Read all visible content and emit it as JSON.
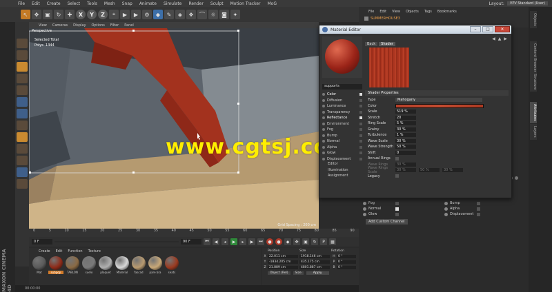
{
  "menubar": [
    "File",
    "Edit",
    "Create",
    "Select",
    "Tools",
    "Mesh",
    "Snap",
    "Animate",
    "Simulate",
    "Render",
    "Sculpt",
    "Motion Tracker",
    "MoG"
  ],
  "layout": {
    "label": "Layout:",
    "value": "VPV Standard (User)"
  },
  "toolbar": {
    "axes": [
      "X",
      "Y",
      "Z"
    ]
  },
  "viewport": {
    "menu": [
      "View",
      "Cameras",
      "Display",
      "Options",
      "Filter",
      "Panel"
    ],
    "label": "Perspective",
    "hud": {
      "selected": "Selected Total",
      "polys_label": "Polys",
      "polys_value": "1344"
    },
    "grid_spacing": "Grid Spacing : 200 cm"
  },
  "timeline": {
    "ticks": [
      "0",
      "5",
      "10",
      "15",
      "20",
      "25",
      "30",
      "35",
      "40",
      "45",
      "50",
      "55",
      "60",
      "65",
      "70",
      "75",
      "80",
      "85",
      "90"
    ],
    "start": "0 F",
    "end": "90 F",
    "current": "0 F"
  },
  "materials": {
    "menu": [
      "Create",
      "Edit",
      "Function",
      "Texture"
    ],
    "items": [
      {
        "name": "Mat",
        "color": "#5a5a5a"
      },
      {
        "name": "subpop",
        "color": "#8e2a18",
        "selected": true
      },
      {
        "name": "TABLON",
        "color": "#8a6a44"
      },
      {
        "name": "suelo",
        "color": "#7a7a7a"
      },
      {
        "name": "plaquet",
        "color": "#b0b0b0"
      },
      {
        "name": "Material",
        "color": "#d8d8d8"
      },
      {
        "name": "fascad",
        "color": "#b89a70"
      },
      {
        "name": "pare bra",
        "color": "#c8a878"
      },
      {
        "name": "seats",
        "color": "#9a3a20"
      }
    ]
  },
  "coords": {
    "headers": [
      "Position",
      "Size",
      "Rotation"
    ],
    "rows": [
      {
        "axis": "X",
        "pos": "22.011 cm",
        "size": "1918.146 cm",
        "rot_axis": "H",
        "rot": "0 °"
      },
      {
        "axis": "Y",
        "pos": "-1834.205 cm",
        "size": "435.175 cm",
        "rot_axis": "P",
        "rot": "0 °"
      },
      {
        "axis": "Z",
        "pos": "21.889 cm",
        "size": "4801.887 cm",
        "rot_axis": "B",
        "rot": "0 °"
      }
    ],
    "mode": "Object (Rel)",
    "size_mode": "Size",
    "apply": "Apply"
  },
  "statusbar": "00:00:00",
  "brand": "MAXON CINEMA 4D",
  "objmgr": {
    "menu": [
      "File",
      "Edit",
      "View",
      "Objects",
      "Tags",
      "Bookmarks"
    ],
    "object": "SUMMERHOUSE3"
  },
  "right_tabs": [
    "Objects",
    "Content Browser",
    "Structure",
    "Attributes",
    "Layers"
  ],
  "attr_lower": {
    "items": [
      {
        "label": "Fog",
        "checked": false
      },
      {
        "label": "Bump",
        "checked": false
      },
      {
        "label": "Normal",
        "checked": true
      },
      {
        "label": "Alpha",
        "checked": false
      },
      {
        "label": "Glow",
        "checked": false
      },
      {
        "label": "Displacement",
        "checked": false
      }
    ],
    "add_channel": "Add Custom Channel"
  },
  "material_editor": {
    "title": "Material Editor",
    "material_name": "supports",
    "tabs": [
      "Back",
      "Shader"
    ],
    "channels": [
      {
        "label": "Color",
        "on": true
      },
      {
        "label": "Diffusion",
        "on": false
      },
      {
        "label": "Luminance",
        "on": false
      },
      {
        "label": "Transparency",
        "on": false
      },
      {
        "label": "Reflectance",
        "on": true
      },
      {
        "label": "Environment",
        "on": false
      },
      {
        "label": "Fog",
        "on": false
      },
      {
        "label": "Bump",
        "on": false
      },
      {
        "label": "Normal",
        "on": false
      },
      {
        "label": "Alpha",
        "on": false
      },
      {
        "label": "Glow",
        "on": false
      },
      {
        "label": "Displacement",
        "on": false
      }
    ],
    "sub_items": [
      "Editor",
      "Illumination",
      "Assignment"
    ],
    "section": "Shader Properties",
    "type_label": "Type",
    "type_value": "Mahogany",
    "color_label": "Color",
    "props": [
      {
        "label": "Scale",
        "value": "519 %"
      },
      {
        "label": "Stretch",
        "value": "20"
      },
      {
        "label": "Ring Scale",
        "value": "5 %"
      },
      {
        "label": "Grainy",
        "value": "30 %"
      },
      {
        "label": "Turbulence",
        "value": "1 %"
      },
      {
        "label": "Wave Scale",
        "value": "30 %"
      },
      {
        "label": "Wave Strength",
        "value": "50 %"
      }
    ],
    "shift_label": "Shift",
    "shift_value": "0",
    "annual_rings": "Annual Rings",
    "wave_rings": "Wave Rings",
    "wave_rings_value": "30 %",
    "wave_rings_scale": "Wave Rings Scale",
    "wave_rings_scale_values": [
      "30 %",
      "50 %",
      "30 %"
    ],
    "legacy": "Legacy"
  },
  "watermark": "www.cgtsj.com"
}
